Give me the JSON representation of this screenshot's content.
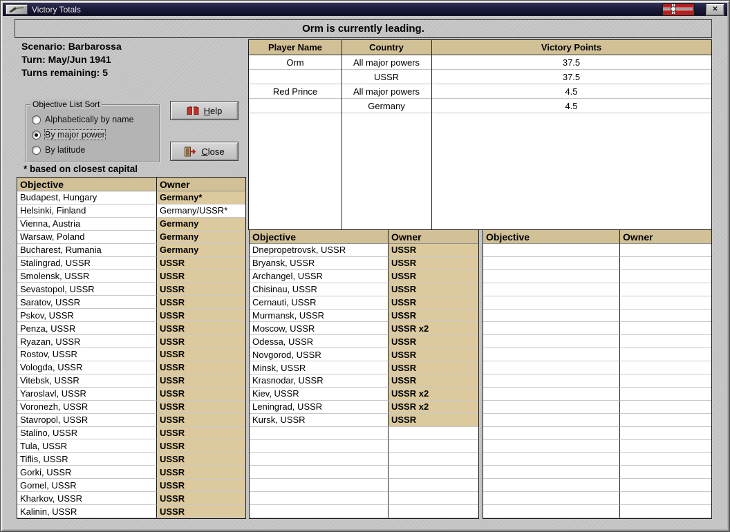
{
  "window": {
    "title": "Victory Totals",
    "banner_text": "Orm is currently leading.",
    "titlebar_close_glyph": "✕"
  },
  "info": {
    "scenario": "Scenario: Barbarossa",
    "turn": "Turn: May/Jun 1941",
    "turns_remaining": "Turns remaining: 5",
    "footnote": "* based on closest capital"
  },
  "sort_box": {
    "legend": "Objective List Sort",
    "options": [
      {
        "label": "Alphabetically by name",
        "selected": false
      },
      {
        "label": "By major power",
        "selected": true
      },
      {
        "label": "By latitude",
        "selected": false
      }
    ]
  },
  "buttons": {
    "help_label": "Help",
    "close_label": "Close"
  },
  "players_table": {
    "headers": [
      "Player Name",
      "Country",
      "Victory Points"
    ],
    "rows": [
      {
        "player": "Orm",
        "country": "All major powers",
        "points": "37.5"
      },
      {
        "player": "",
        "country": "USSR",
        "points": "37.5"
      },
      {
        "player": "Red Prince",
        "country": "All major powers",
        "points": "4.5"
      },
      {
        "player": "",
        "country": "Germany",
        "points": "4.5"
      }
    ]
  },
  "objective_tables": [
    {
      "headers": [
        "Objective",
        "Owner"
      ],
      "row_slots": 25,
      "rows": [
        {
          "objective": "Budapest, Hungary",
          "owner": "Germany*",
          "tan": true
        },
        {
          "objective": "Helsinki, Finland",
          "owner": "Germany/USSR*",
          "tan": false
        },
        {
          "objective": "Vienna, Austria",
          "owner": "Germany",
          "tan": true
        },
        {
          "objective": "Warsaw, Poland",
          "owner": "Germany",
          "tan": true
        },
        {
          "objective": "Bucharest, Rumania",
          "owner": "Germany",
          "tan": true
        },
        {
          "objective": "Stalingrad, USSR",
          "owner": "USSR",
          "tan": true
        },
        {
          "objective": "Smolensk, USSR",
          "owner": "USSR",
          "tan": true
        },
        {
          "objective": "Sevastopol, USSR",
          "owner": "USSR",
          "tan": true
        },
        {
          "objective": "Saratov, USSR",
          "owner": "USSR",
          "tan": true
        },
        {
          "objective": "Pskov, USSR",
          "owner": "USSR",
          "tan": true
        },
        {
          "objective": "Penza, USSR",
          "owner": "USSR",
          "tan": true
        },
        {
          "objective": "Ryazan, USSR",
          "owner": "USSR",
          "tan": true
        },
        {
          "objective": "Rostov, USSR",
          "owner": "USSR",
          "tan": true
        },
        {
          "objective": "Vologda, USSR",
          "owner": "USSR",
          "tan": true
        },
        {
          "objective": "Vitebsk, USSR",
          "owner": "USSR",
          "tan": true
        },
        {
          "objective": "Yaroslavl, USSR",
          "owner": "USSR",
          "tan": true
        },
        {
          "objective": "Voronezh, USSR",
          "owner": "USSR",
          "tan": true
        },
        {
          "objective": "Stavropol, USSR",
          "owner": "USSR",
          "tan": true
        },
        {
          "objective": "Stalino, USSR",
          "owner": "USSR",
          "tan": true
        },
        {
          "objective": "Tula, USSR",
          "owner": "USSR",
          "tan": true
        },
        {
          "objective": "Tiflis, USSR",
          "owner": "USSR",
          "tan": true
        },
        {
          "objective": "Gorki, USSR",
          "owner": "USSR",
          "tan": true
        },
        {
          "objective": "Gomel, USSR",
          "owner": "USSR",
          "tan": true
        },
        {
          "objective": "Kharkov, USSR",
          "owner": "USSR",
          "tan": true
        },
        {
          "objective": "Kalinin, USSR",
          "owner": "USSR",
          "tan": true
        }
      ]
    },
    {
      "headers": [
        "Objective",
        "Owner"
      ],
      "row_slots": 21,
      "rows": [
        {
          "objective": "Dnepropetrovsk, USSR",
          "owner": "USSR",
          "tan": true
        },
        {
          "objective": "Bryansk, USSR",
          "owner": "USSR",
          "tan": true
        },
        {
          "objective": "Archangel, USSR",
          "owner": "USSR",
          "tan": true
        },
        {
          "objective": "Chisinau, USSR",
          "owner": "USSR",
          "tan": true
        },
        {
          "objective": "Cernauti, USSR",
          "owner": "USSR",
          "tan": true
        },
        {
          "objective": "Murmansk, USSR",
          "owner": "USSR",
          "tan": true
        },
        {
          "objective": "Moscow, USSR",
          "owner": "USSR x2",
          "tan": true
        },
        {
          "objective": "Odessa, USSR",
          "owner": "USSR",
          "tan": true
        },
        {
          "objective": "Novgorod, USSR",
          "owner": "USSR",
          "tan": true
        },
        {
          "objective": "Minsk, USSR",
          "owner": "USSR",
          "tan": true
        },
        {
          "objective": "Krasnodar, USSR",
          "owner": "USSR",
          "tan": true
        },
        {
          "objective": "Kiev, USSR",
          "owner": "USSR x2",
          "tan": true
        },
        {
          "objective": "Leningrad, USSR",
          "owner": "USSR x2",
          "tan": true
        },
        {
          "objective": "Kursk, USSR",
          "owner": "USSR",
          "tan": true
        }
      ]
    },
    {
      "headers": [
        "Objective",
        "Owner"
      ],
      "row_slots": 21,
      "rows": []
    }
  ],
  "colors": {
    "tan_header": "#d2c096",
    "tan_cell": "#dcca9e",
    "flag_red": "#b61f1f"
  }
}
